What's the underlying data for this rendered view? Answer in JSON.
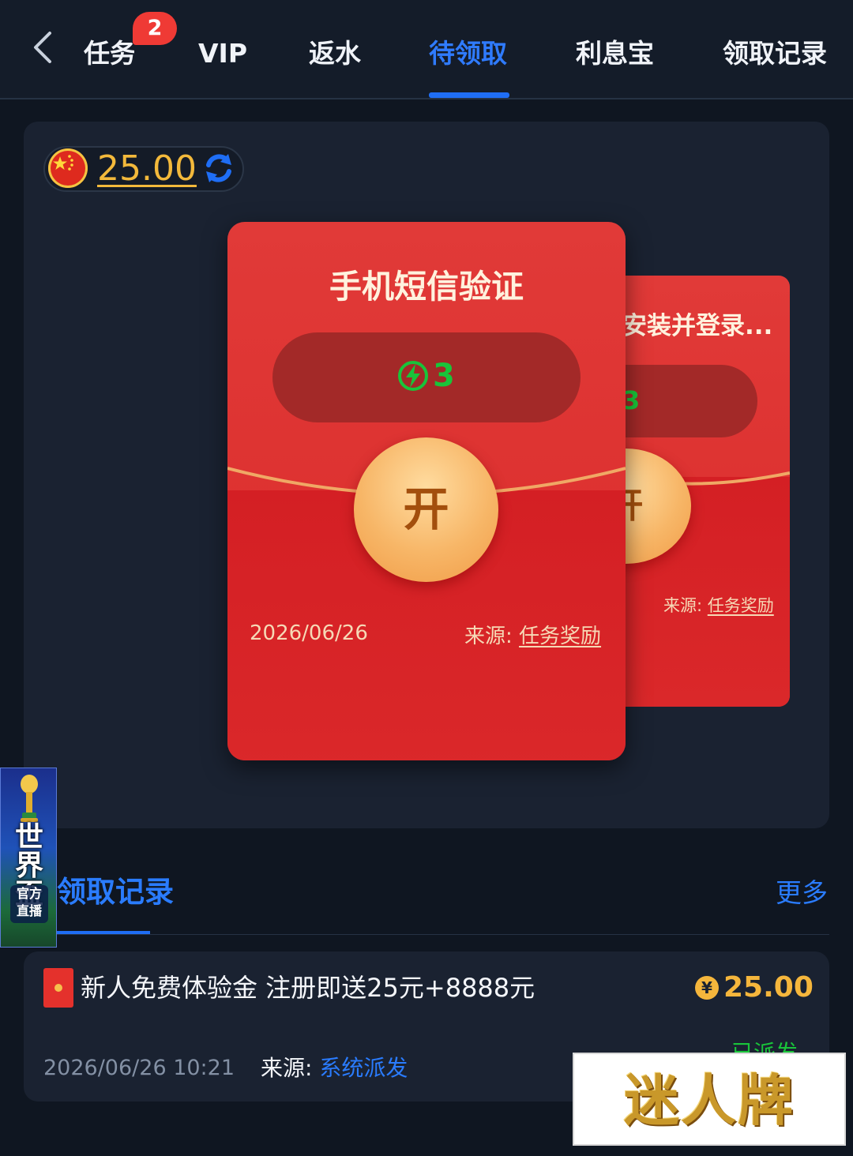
{
  "nav": {
    "tabs": [
      {
        "label": "任务",
        "active": false
      },
      {
        "label": "VIP",
        "active": false
      },
      {
        "label": "返水",
        "active": false
      },
      {
        "label": "待领取",
        "active": true
      },
      {
        "label": "利息宝",
        "active": false
      },
      {
        "label": "领取记录",
        "active": false
      }
    ],
    "task_badge": "2",
    "back_icon": "chevron-left-icon"
  },
  "balance": {
    "value": "25.00",
    "flag_icon": "china-flag-icon",
    "refresh_icon": "refresh-icon"
  },
  "envelopes": [
    {
      "title": "手机短信验证",
      "count": "3",
      "open_label": "开",
      "date": "2026/06/26",
      "source_label": "来源:",
      "source_value": "任务奖励"
    },
    {
      "title": "安装并登录...",
      "count": "3",
      "open_label": "开",
      "source_label": "来源:",
      "source_value": "任务奖励"
    }
  ],
  "worldcup_ad": {
    "title": "世界盃",
    "subtitle_1": "官方",
    "subtitle_2": "直播"
  },
  "records": {
    "title": "领取记录",
    "more_label": "更多",
    "items": [
      {
        "name": "新人免费体验金 注册即送25元+8888元",
        "amount": "25.00",
        "currency_symbol": "¥",
        "status": "已派发",
        "time": "2026/06/26 10:21",
        "source_label": "来源:",
        "source_value": "系统派发"
      }
    ]
  },
  "watermark": "迷人牌",
  "colors": {
    "accent_blue": "#1f6ef5",
    "gold": "#f5b63c",
    "envelope_red": "#e13a38",
    "status_green": "#19c43a"
  }
}
